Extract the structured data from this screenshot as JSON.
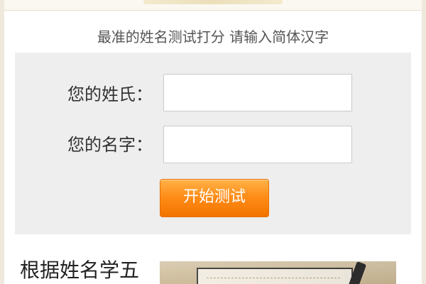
{
  "header": {
    "subtitle": "最准的姓名测试打分 请输入简体汉字"
  },
  "form": {
    "surname_label": "您的姓氏：",
    "surname_value": "",
    "name_label": "您的名字：",
    "name_value": "",
    "start_button_label": "开始测试"
  },
  "article": {
    "title": "根据姓名学五"
  },
  "colors": {
    "panel_background": "#eeeeee",
    "button_orange": "#ff8c17",
    "border_beige": "#efe9dd"
  },
  "icons": {
    "thumbnail": "calligraphy-paper-image"
  }
}
